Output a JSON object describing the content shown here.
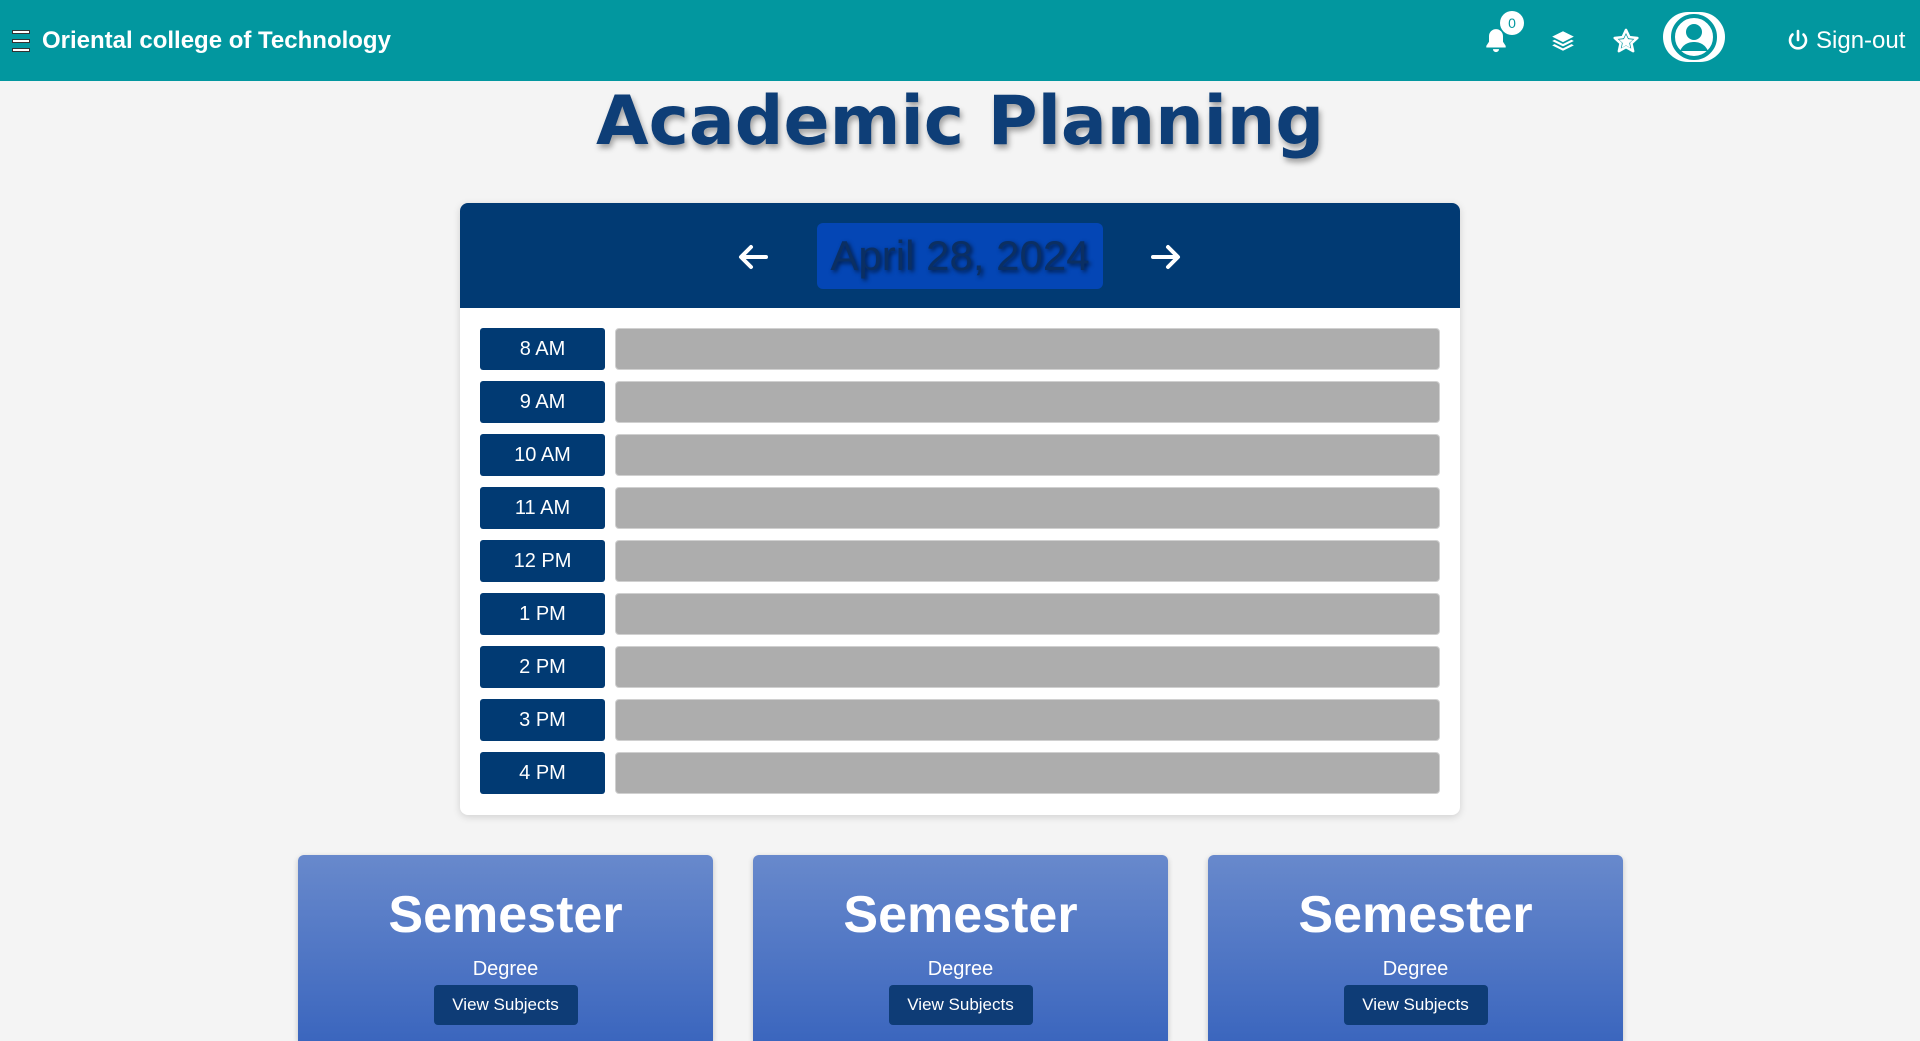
{
  "navbar": {
    "brand": "Oriental college of Technology",
    "notification_count": "0",
    "signout_label": "Sign-out"
  },
  "page": {
    "title": "Academic Planning"
  },
  "calendar": {
    "date": "April 28, 2024",
    "slots": [
      {
        "time": "8 AM"
      },
      {
        "time": "9 AM"
      },
      {
        "time": "10 AM"
      },
      {
        "time": "11 AM"
      },
      {
        "time": "12 PM"
      },
      {
        "time": "1 PM"
      },
      {
        "time": "2 PM"
      },
      {
        "time": "3 PM"
      },
      {
        "time": "4 PM"
      }
    ]
  },
  "cards": [
    {
      "title": "Semester",
      "subtitle": "Degree",
      "button": "View Subjects"
    },
    {
      "title": "Semester",
      "subtitle": "Degree",
      "button": "View Subjects"
    },
    {
      "title": "Semester",
      "subtitle": "Degree",
      "button": "View Subjects"
    }
  ],
  "colors": {
    "navbar": "#02979f",
    "primary": "#013a73",
    "date_box": "#0446b5",
    "slot_field": "#adadad",
    "card_top": "#6889cc",
    "card_bottom": "#3b66be"
  }
}
